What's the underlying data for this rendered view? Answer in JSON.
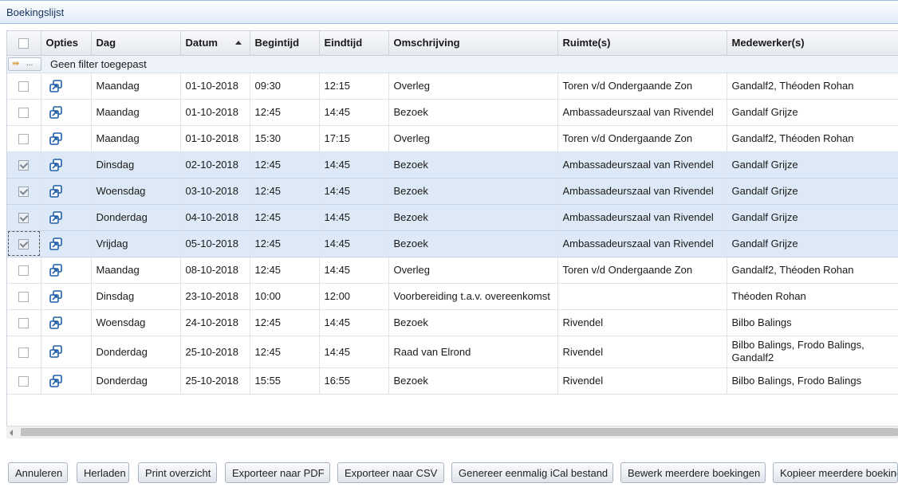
{
  "window": {
    "title": "Boekingslijst"
  },
  "grid": {
    "columns": [
      "Opties",
      "Dag",
      "Datum",
      "Begintijd",
      "Eindtijd",
      "Omschrijving",
      "Ruimte(s)",
      "Medewerker(s)"
    ],
    "sort_column": "Datum",
    "sort_direction": "ascending",
    "filter_text": "Geen filter toegepast",
    "filter_button_label": "...",
    "rows": [
      {
        "selected": false,
        "dag": "Maandag",
        "datum": "01-10-2018",
        "begintijd": "09:30",
        "eindtijd": "12:15",
        "omschrijving": "Overleg",
        "ruimte": "Toren v/d Ondergaande Zon",
        "medewerker": "Gandalf2, Théoden Rohan"
      },
      {
        "selected": false,
        "dag": "Maandag",
        "datum": "01-10-2018",
        "begintijd": "12:45",
        "eindtijd": "14:45",
        "omschrijving": "Bezoek",
        "ruimte": "Ambassadeurszaal van Rivendel",
        "medewerker": "Gandalf Grijze"
      },
      {
        "selected": false,
        "dag": "Maandag",
        "datum": "01-10-2018",
        "begintijd": "15:30",
        "eindtijd": "17:15",
        "omschrijving": "Overleg",
        "ruimte": "Toren v/d Ondergaande Zon",
        "medewerker": "Gandalf2, Théoden Rohan"
      },
      {
        "selected": true,
        "dag": "Dinsdag",
        "datum": "02-10-2018",
        "begintijd": "12:45",
        "eindtijd": "14:45",
        "omschrijving": "Bezoek",
        "ruimte": "Ambassadeurszaal van Rivendel",
        "medewerker": "Gandalf Grijze"
      },
      {
        "selected": true,
        "dag": "Woensdag",
        "datum": "03-10-2018",
        "begintijd": "12:45",
        "eindtijd": "14:45",
        "omschrijving": "Bezoek",
        "ruimte": "Ambassadeurszaal van Rivendel",
        "medewerker": "Gandalf Grijze"
      },
      {
        "selected": true,
        "dag": "Donderdag",
        "datum": "04-10-2018",
        "begintijd": "12:45",
        "eindtijd": "14:45",
        "omschrijving": "Bezoek",
        "ruimte": "Ambassadeurszaal van Rivendel",
        "medewerker": "Gandalf Grijze"
      },
      {
        "selected": true,
        "dag": "Vrijdag",
        "datum": "05-10-2018",
        "begintijd": "12:45",
        "eindtijd": "14:45",
        "omschrijving": "Bezoek",
        "ruimte": "Ambassadeurszaal van Rivendel",
        "medewerker": "Gandalf Grijze"
      },
      {
        "selected": false,
        "dag": "Maandag",
        "datum": "08-10-2018",
        "begintijd": "12:45",
        "eindtijd": "14:45",
        "omschrijving": "Overleg",
        "ruimte": "Toren v/d Ondergaande Zon",
        "medewerker": "Gandalf2, Théoden Rohan"
      },
      {
        "selected": false,
        "dag": "Dinsdag",
        "datum": "23-10-2018",
        "begintijd": "10:00",
        "eindtijd": "12:00",
        "omschrijving": "Voorbereiding t.a.v. overeenkomst",
        "ruimte": "",
        "medewerker": "Théoden Rohan"
      },
      {
        "selected": false,
        "dag": "Woensdag",
        "datum": "24-10-2018",
        "begintijd": "12:45",
        "eindtijd": "14:45",
        "omschrijving": "Bezoek",
        "ruimte": "Rivendel",
        "medewerker": "Bilbo Balings"
      },
      {
        "selected": false,
        "dag": "Donderdag",
        "datum": "25-10-2018",
        "begintijd": "12:45",
        "eindtijd": "14:45",
        "omschrijving": "Raad van Elrond",
        "ruimte": "Rivendel",
        "medewerker": "Bilbo Balings, Frodo Balings, Gandalf2"
      },
      {
        "selected": false,
        "dag": "Donderdag",
        "datum": "25-10-2018",
        "begintijd": "15:55",
        "eindtijd": "16:55",
        "omschrijving": "Bezoek",
        "ruimte": "Rivendel",
        "medewerker": "Bilbo Balings, Frodo Balings"
      }
    ]
  },
  "buttons": [
    "Annuleren",
    "Herladen",
    "Print overzicht",
    "Exporteer naar PDF",
    "Exporteer naar CSV",
    "Genereer eenmalig iCal bestand",
    "Bewerk meerdere boekingen",
    "Kopieer meerdere boekingen"
  ],
  "colors": {
    "accent": "#1f5fa8",
    "selected_row": "#dde9f6",
    "titlebar": "#e1ecfa"
  },
  "icons": {
    "options": "open-in-window-icon",
    "filter": "filter-arrow-icon"
  }
}
